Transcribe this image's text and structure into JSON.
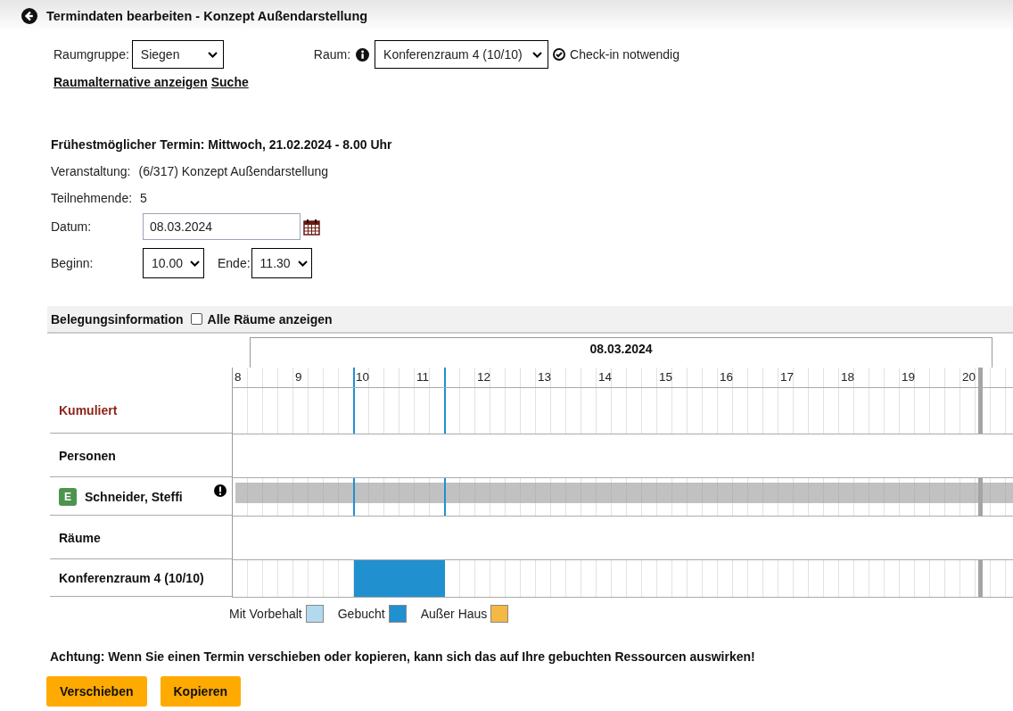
{
  "header": {
    "title": "Termindaten bearbeiten - Konzept Außendarstellung"
  },
  "room_group": {
    "label": "Raumgruppe:",
    "value": "Siegen"
  },
  "room": {
    "label": "Raum:",
    "value": "Konferenzraum 4 (10/10)",
    "note": "Check-in notwendig"
  },
  "links": [
    "Raumalternative anzeigen",
    "Suche"
  ],
  "earliest": "Frühestmöglicher Termin: Mittwoch, 21.02.2024 - 8.00 Uhr",
  "details": [
    {
      "label": "Veranstaltung:",
      "value": "(6/317) Konzept Außendarstellung"
    },
    {
      "label": "Teilnehmende:",
      "value": "5"
    }
  ],
  "date": {
    "label": "Datum:",
    "value": "08.03.2024"
  },
  "begin": {
    "label": "Beginn:",
    "value": "10.00"
  },
  "end": {
    "label": "Ende:",
    "value": "11.30"
  },
  "occupancy": {
    "title": "Belegungsinformation",
    "show_all": {
      "label": "Alle Räume anzeigen",
      "checked": false
    },
    "day": "08.03.2024",
    "hours": [
      "8",
      "9",
      "10",
      "11",
      "12",
      "13",
      "14",
      "15",
      "16",
      "17",
      "18",
      "19",
      "20"
    ],
    "rows": [
      {
        "kind": "cumulative",
        "label": "Kumuliert"
      },
      {
        "kind": "section",
        "label": "Personen"
      },
      {
        "kind": "person",
        "label": "Schneider, Steffi",
        "badge": "E",
        "color": "#4e944f",
        "busy": true,
        "warning": true
      },
      {
        "kind": "section",
        "label": "Räume"
      },
      {
        "kind": "room",
        "label": "Konferenzraum 4 (10/10)",
        "booked": true
      }
    ],
    "legend": [
      {
        "label": "Mit Vorbehalt",
        "color": "#b3d9ee"
      },
      {
        "label": "Gebucht",
        "color": "#2190cf"
      },
      {
        "label": "Außer Haus",
        "color": "#f4b942"
      }
    ]
  },
  "warning": "Achtung: Wenn Sie einen Termin verschieben oder kopieren, kann sich das auf Ihre gebuchten Ressourcen auswirken!",
  "buttons": [
    "Verschieben",
    "Kopieren"
  ]
}
